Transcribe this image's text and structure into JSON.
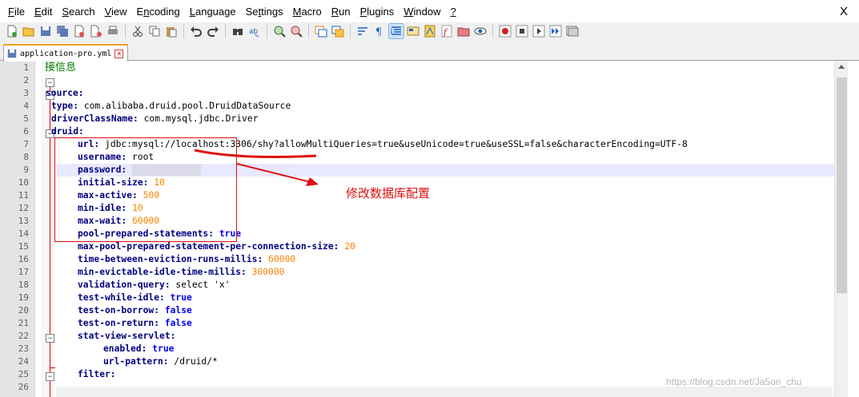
{
  "menu": {
    "items": [
      "File",
      "Edit",
      "Search",
      "View",
      "Encoding",
      "Language",
      "Settings",
      "Macro",
      "Run",
      "Plugins",
      "Window",
      "?"
    ],
    "close": "X"
  },
  "toolbar": {
    "icons": [
      "new-file-icon",
      "open-file-icon",
      "save-icon",
      "save-all-icon",
      "close-icon",
      "close-all-icon",
      "print-icon",
      "cut-icon",
      "copy-icon",
      "paste-icon",
      "undo-icon",
      "redo-icon",
      "find-icon",
      "replace-icon",
      "zoom-in-icon",
      "zoom-out-icon",
      "sync-v-icon",
      "sync-h-icon",
      "wrap-icon",
      "all-chars-icon",
      "indent-guide-icon",
      "udl-icon",
      "doc-map-icon",
      "function-list-icon",
      "folder-workspace-icon",
      "monitor-icon",
      "record-macro-icon",
      "stop-record-icon",
      "play-macro-icon",
      "run-multiple-icon",
      "save-macro-icon"
    ]
  },
  "tab": {
    "filename": "application-pro.yml"
  },
  "editor": {
    "line_numbers": [
      "1",
      "2",
      "3",
      "4",
      "5",
      "6",
      "7",
      "8",
      "9",
      "10",
      "11",
      "12",
      "13",
      "14",
      "15",
      "16",
      "17",
      "18",
      "19",
      "20",
      "21",
      "22",
      "23",
      "24",
      "25",
      "26"
    ],
    "lines": {
      "l1": "接信息",
      "l3": "source:",
      "l4_key": "type:",
      "l4_val": " com.alibaba.druid.pool.DruidDataSource",
      "l5_key": "driverClassName:",
      "l5_val": " com.mysql.jdbc.Driver",
      "l6": "druid:",
      "l7_key": "url:",
      "l7_val": " jdbc:mysql://localhost:3306/shy?allowMultiQueries=true&useUnicode=true&useSSL=false&characterEncoding=UTF-8",
      "l8_key": "username:",
      "l8_val": " root",
      "l9_key": "password:",
      "l10_key": "initial-size:",
      "l10_val": " 10",
      "l11_key": "max-active:",
      "l11_val": " 500",
      "l12_key": "min-idle:",
      "l12_val": " 10",
      "l13_key": "max-wait:",
      "l13_val": " 60000",
      "l14_key": "pool-prepared-statements:",
      "l14_val": " true",
      "l15_key": "max-pool-prepared-statement-per-connection-size:",
      "l15_val": " 20",
      "l16_key": "time-between-eviction-runs-millis:",
      "l16_val": " 60000",
      "l17_key": "min-evictable-idle-time-millis:",
      "l17_val": " 300000",
      "l18_key": "validation-query:",
      "l18_val": " select 'x'",
      "l19_key": "test-while-idle:",
      "l19_val": " true",
      "l20_key": "test-on-borrow:",
      "l20_val": " false",
      "l21_key": "test-on-return:",
      "l21_val": " false",
      "l22_key": "stat-view-servlet:",
      "l23_key": "enabled:",
      "l23_val": " true",
      "l24_key": "url-pattern:",
      "l24_val": " /druid/*",
      "l25_key": "filter:"
    }
  },
  "annotation": {
    "text": "修改数据库配置"
  },
  "watermark": "https://blog.csdn.net/Ja5on_chu",
  "colors": {
    "key": "#000080",
    "number": "#ff8000",
    "boolean": "#0000ff",
    "comment": "#008000",
    "annotation": "#e01010"
  }
}
